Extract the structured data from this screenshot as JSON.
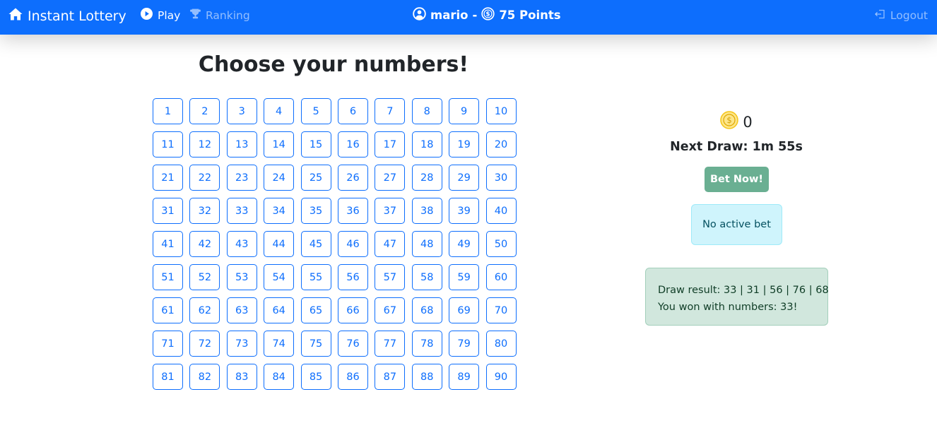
{
  "navbar": {
    "brand": "Instant Lottery",
    "play": "Play",
    "ranking": "Ranking",
    "username": "mario",
    "separator": "-",
    "points": "75 Points",
    "logout": "Logout"
  },
  "main": {
    "title": "Choose your numbers!",
    "numbers": [
      "1",
      "2",
      "3",
      "4",
      "5",
      "6",
      "7",
      "8",
      "9",
      "10",
      "11",
      "12",
      "13",
      "14",
      "15",
      "16",
      "17",
      "18",
      "19",
      "20",
      "21",
      "22",
      "23",
      "24",
      "25",
      "26",
      "27",
      "28",
      "29",
      "30",
      "31",
      "32",
      "33",
      "34",
      "35",
      "36",
      "37",
      "38",
      "39",
      "40",
      "41",
      "42",
      "43",
      "44",
      "45",
      "46",
      "47",
      "48",
      "49",
      "50",
      "51",
      "52",
      "53",
      "54",
      "55",
      "56",
      "57",
      "58",
      "59",
      "60",
      "61",
      "62",
      "63",
      "64",
      "65",
      "66",
      "67",
      "68",
      "69",
      "70",
      "71",
      "72",
      "73",
      "74",
      "75",
      "76",
      "77",
      "78",
      "79",
      "80",
      "81",
      "82",
      "83",
      "84",
      "85",
      "86",
      "87",
      "88",
      "89",
      "90"
    ]
  },
  "sidebar": {
    "coins": "0",
    "next_draw": "Next Draw: 1m 55s",
    "bet_button": "Bet Now!",
    "no_bet": "No active bet",
    "draw_result": "Draw result: 33 | 31 | 56 | 76 | 68",
    "won_message": "You won with numbers: 33!"
  },
  "colors": {
    "primary": "#0d6efd",
    "bet_button": "#6aaf92",
    "info_bg": "#cff4fc",
    "success_bg": "#d1e7dd",
    "coin": "#f5c518"
  }
}
